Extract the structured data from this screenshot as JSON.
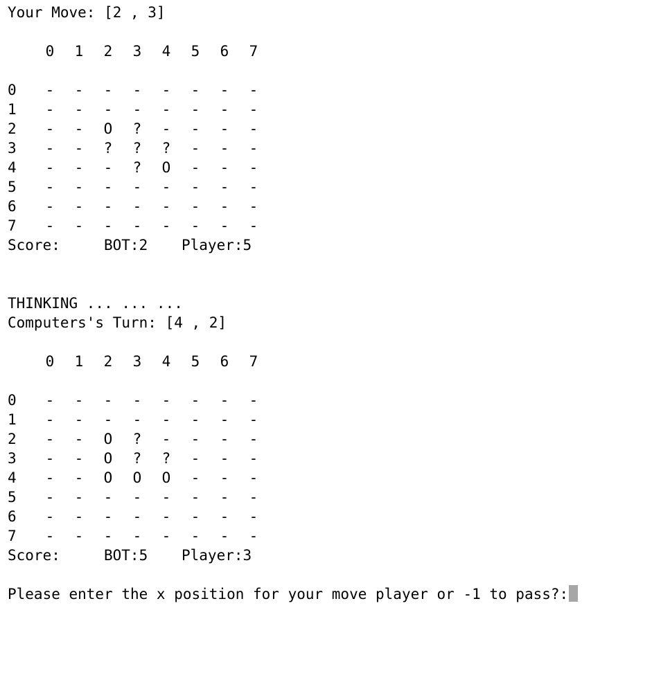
{
  "terminal": {
    "move_header": "Your Move: [2 , 3]",
    "thinking": "THINKING ... ... ...",
    "computer_header": "Computers's Turn: [4 , 2]",
    "prompt": "Please enter the x position for your move player or -1 to pass?:",
    "cursor_color": "#a6a6a6"
  },
  "boards": [
    {
      "col_labels": [
        "0",
        "1",
        "2",
        "3",
        "4",
        "5",
        "6",
        "7"
      ],
      "row_labels": [
        "0",
        "1",
        "2",
        "3",
        "4",
        "5",
        "6",
        "7"
      ],
      "cells": [
        [
          "-",
          "-",
          "-",
          "-",
          "-",
          "-",
          "-",
          "-"
        ],
        [
          "-",
          "-",
          "-",
          "-",
          "-",
          "-",
          "-",
          "-"
        ],
        [
          "-",
          "-",
          "O",
          "?",
          "-",
          "-",
          "-",
          "-"
        ],
        [
          "-",
          "-",
          "?",
          "?",
          "?",
          "-",
          "-",
          "-"
        ],
        [
          "-",
          "-",
          "-",
          "?",
          "O",
          "-",
          "-",
          "-"
        ],
        [
          "-",
          "-",
          "-",
          "-",
          "-",
          "-",
          "-",
          "-"
        ],
        [
          "-",
          "-",
          "-",
          "-",
          "-",
          "-",
          "-",
          "-"
        ],
        [
          "-",
          "-",
          "-",
          "-",
          "-",
          "-",
          "-",
          "-"
        ]
      ],
      "score_label": "Score:",
      "bot_score": "BOT:2",
      "player_score": "Player:5"
    },
    {
      "col_labels": [
        "0",
        "1",
        "2",
        "3",
        "4",
        "5",
        "6",
        "7"
      ],
      "row_labels": [
        "0",
        "1",
        "2",
        "3",
        "4",
        "5",
        "6",
        "7"
      ],
      "cells": [
        [
          "-",
          "-",
          "-",
          "-",
          "-",
          "-",
          "-",
          "-"
        ],
        [
          "-",
          "-",
          "-",
          "-",
          "-",
          "-",
          "-",
          "-"
        ],
        [
          "-",
          "-",
          "O",
          "?",
          "-",
          "-",
          "-",
          "-"
        ],
        [
          "-",
          "-",
          "O",
          "?",
          "?",
          "-",
          "-",
          "-"
        ],
        [
          "-",
          "-",
          "O",
          "O",
          "O",
          "-",
          "-",
          "-"
        ],
        [
          "-",
          "-",
          "-",
          "-",
          "-",
          "-",
          "-",
          "-"
        ],
        [
          "-",
          "-",
          "-",
          "-",
          "-",
          "-",
          "-",
          "-"
        ],
        [
          "-",
          "-",
          "-",
          "-",
          "-",
          "-",
          "-",
          "-"
        ]
      ],
      "score_label": "Score:",
      "bot_score": "BOT:5",
      "player_score": "Player:3"
    }
  ]
}
